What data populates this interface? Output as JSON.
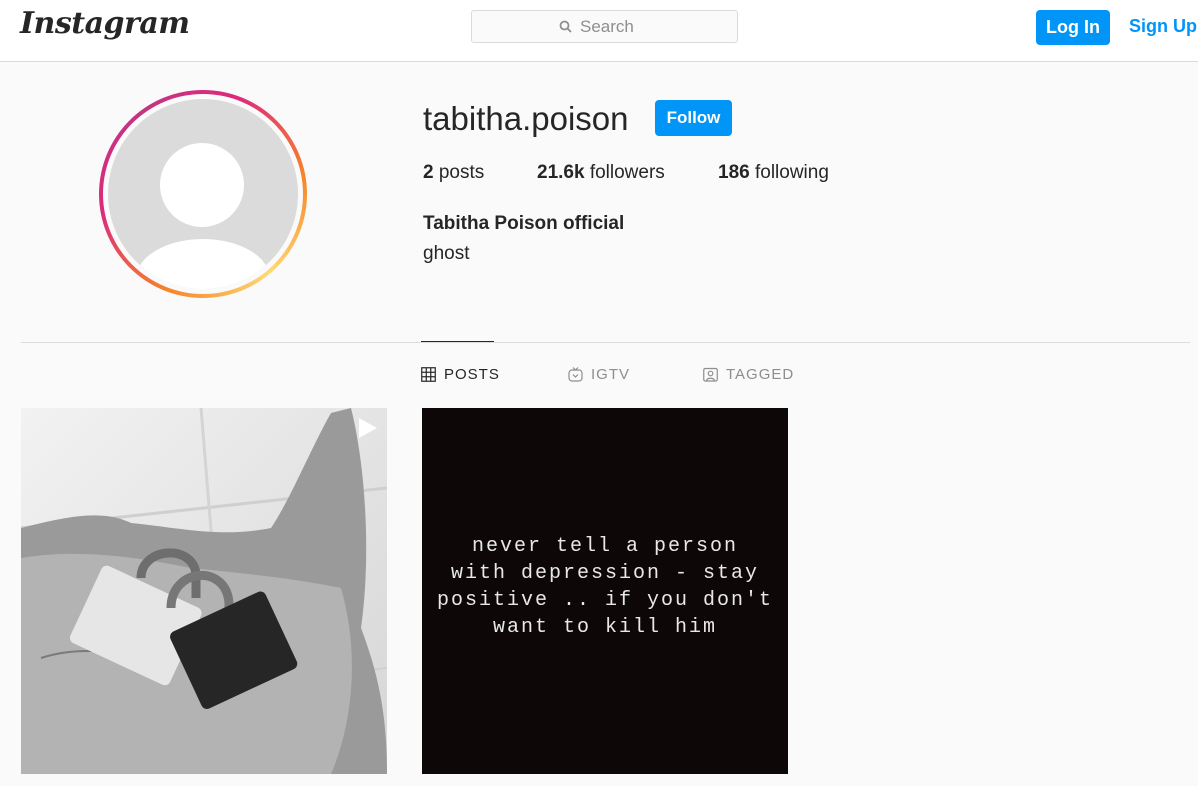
{
  "header": {
    "logo": "Instagram",
    "search_placeholder": "Search",
    "login_label": "Log In",
    "signup_label": "Sign Up"
  },
  "profile": {
    "username": "tabitha.poison",
    "follow_label": "Follow",
    "posts_count": "2",
    "posts_label": "posts",
    "followers_count": "21.6k",
    "followers_label": "followers",
    "following_count": "186",
    "following_label": "following",
    "full_name": "Tabitha Poison official",
    "bio": "ghost"
  },
  "tabs": [
    {
      "label": "POSTS",
      "icon": "grid-icon",
      "active": true
    },
    {
      "label": "IGTV",
      "icon": "igtv-icon",
      "active": false
    },
    {
      "label": "TAGGED",
      "icon": "tagged-icon",
      "active": false
    }
  ],
  "posts": [
    {
      "type": "video",
      "icon": "video-icon"
    },
    {
      "type": "image",
      "text": "never tell a person\nwith depression - stay\npositive .. if you don't\nwant to kill him"
    }
  ],
  "colors": {
    "accent": "#0095f6",
    "text": "#262626",
    "muted": "#8e8e8e",
    "border": "#dbdbdb",
    "background": "#fafafa"
  }
}
